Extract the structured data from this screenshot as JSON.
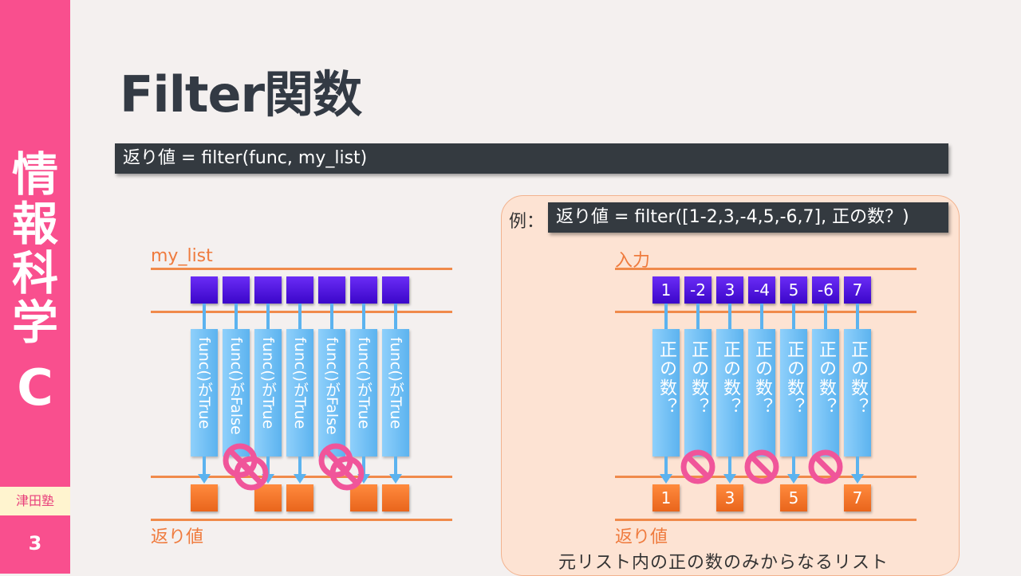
{
  "sidebar": {
    "course_lines": [
      "情",
      "報",
      "科",
      "学"
    ],
    "course_letter": "C",
    "school": "津田塾",
    "page_number": "3"
  },
  "title": "Filter関数",
  "syntax": "返り値 = filter(func, my_list)",
  "example": {
    "label": "例：",
    "code": "返り値 = filter([1-2,3,-4,5,-6,7], 正の数？)",
    "input_label": "入力",
    "inputs": [
      "1",
      "-2",
      "3",
      "-4",
      "5",
      "-6",
      "7"
    ],
    "test_label": "正の数？",
    "outputs": [
      "1",
      "3",
      "5",
      "7"
    ],
    "output_label": "返り値",
    "caption": "元リスト内の正の数のみからなるリスト"
  },
  "diagram": {
    "list_label": "my_list",
    "tests": [
      "func()がTrue",
      "func()がFalse",
      "func()がTrue",
      "func()がTrue",
      "func()がFalse",
      "func()がTrue",
      "func()がTrue"
    ],
    "output_label": "返り値"
  },
  "colors": {
    "sidebar": "#f94f8e",
    "input_box": "#4a12dd",
    "output_box": "#f47a2e",
    "test_pill": "#76c3f5",
    "no_symbol": "#f0559a"
  },
  "icons": {
    "reject": "no-entry-icon"
  }
}
